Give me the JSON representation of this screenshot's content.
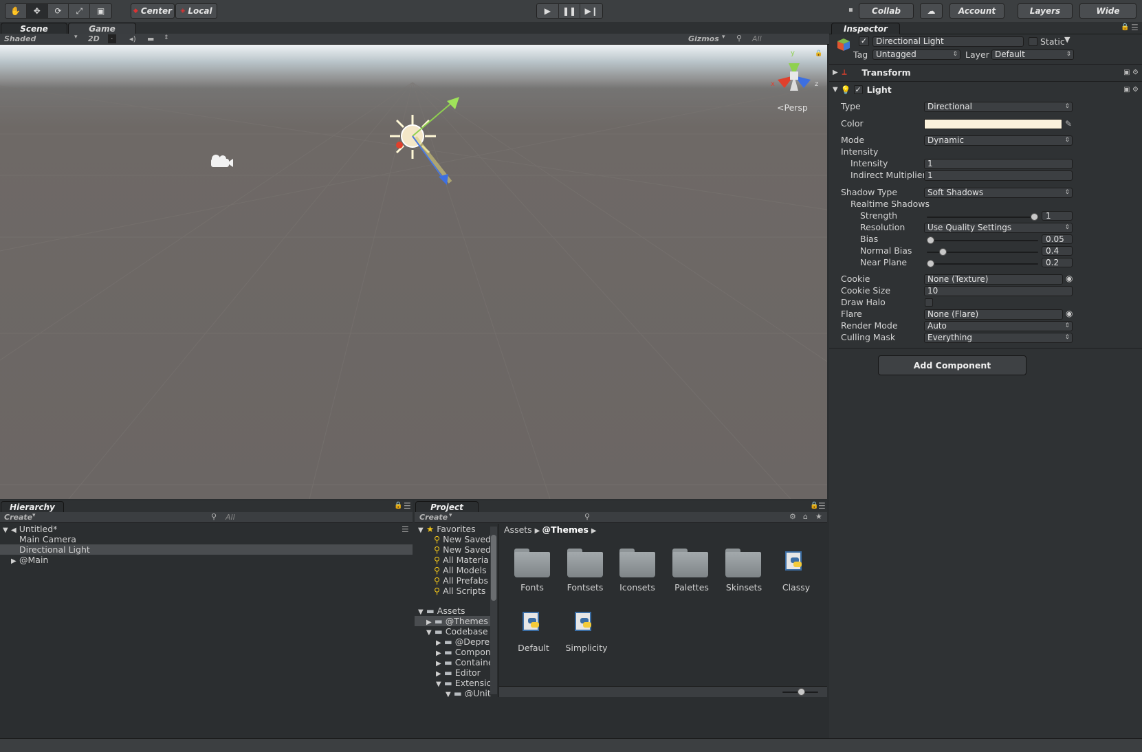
{
  "toolbar": {
    "pivot_label": "Center",
    "space_label": "Local",
    "collab_label": "Collab",
    "account_label": "Account",
    "layers_label": "Layers",
    "layout_label": "Wide"
  },
  "scene_panel": {
    "tabs": [
      "Scene",
      "Game"
    ],
    "shading_mode": "Shaded",
    "mode_2d": "2D",
    "gizmos_label": "Gizmos",
    "search_placeholder": "All",
    "projection_label": "Persp",
    "gizmo_axes": {
      "x": "x",
      "y": "y",
      "z": "z"
    }
  },
  "inspector": {
    "tab": "Inspector",
    "object_name": "Directional Light",
    "active": true,
    "static_label": "Static",
    "tag_label": "Tag",
    "tag_value": "Untagged",
    "layer_label": "Layer",
    "layer_value": "Default",
    "transform_label": "Transform",
    "light_label": "Light",
    "light_enabled": true,
    "properties": {
      "type": {
        "label": "Type",
        "value": "Directional"
      },
      "color": {
        "label": "Color",
        "value": "#fbf2dc"
      },
      "mode": {
        "label": "Mode",
        "value": "Dynamic"
      },
      "intensity_header": "Intensity",
      "intensity": {
        "label": "Intensity",
        "value": "1"
      },
      "indirect": {
        "label": "Indirect Multiplier",
        "value": "1"
      },
      "shadow_type": {
        "label": "Shadow Type",
        "value": "Soft Shadows"
      },
      "realtime_shadows": "Realtime Shadows",
      "strength": {
        "label": "Strength",
        "value": "1",
        "fraction": 1.0
      },
      "resolution": {
        "label": "Resolution",
        "value": "Use Quality Settings"
      },
      "bias": {
        "label": "Bias",
        "value": "0.05",
        "fraction": 0.0
      },
      "normal_bias": {
        "label": "Normal Bias",
        "value": "0.4",
        "fraction": 0.12
      },
      "near_plane": {
        "label": "Near Plane",
        "value": "0.2",
        "fraction": 0.0
      },
      "cookie": {
        "label": "Cookie",
        "value": "None (Texture)"
      },
      "cookie_size": {
        "label": "Cookie Size",
        "value": "10"
      },
      "draw_halo": {
        "label": "Draw Halo",
        "value": false
      },
      "flare": {
        "label": "Flare",
        "value": "None (Flare)"
      },
      "render_mode": {
        "label": "Render Mode",
        "value": "Auto"
      },
      "culling_mask": {
        "label": "Culling Mask",
        "value": "Everything"
      }
    },
    "add_component_label": "Add Component"
  },
  "hierarchy": {
    "tab": "Hierarchy",
    "create_label": "Create",
    "search_placeholder": "All",
    "scene_name": "Untitled*",
    "items": [
      "Main Camera",
      "Directional Light",
      "@Main"
    ]
  },
  "project": {
    "tab": "Project",
    "create_label": "Create",
    "favorites_label": "Favorites",
    "favorites": [
      "New Saved",
      "New Saved",
      "All Materia",
      "All Models",
      "All Prefabs",
      "All Scripts"
    ],
    "assets_label": "Assets",
    "tree": [
      "@Themes",
      "Codebase",
      "@Deprec",
      "Compon",
      "Containe",
      "Editor",
      "Extensio",
      "@Unit"
    ],
    "breadcrumb": [
      "Assets",
      "@Themes"
    ],
    "grid_folders": [
      "Fonts",
      "Fontsets",
      "Iconsets",
      "Palettes",
      "Skinsets"
    ],
    "grid_scripts": [
      "Classy",
      "Default",
      "Simplicity"
    ]
  }
}
